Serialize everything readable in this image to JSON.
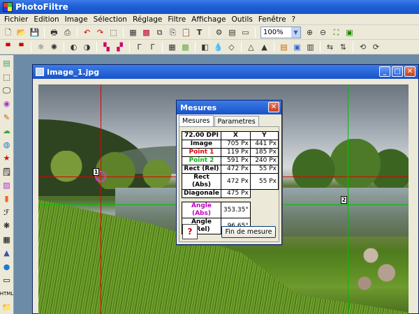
{
  "app": {
    "title": "PhotoFiltre"
  },
  "menu": [
    "Fichier",
    "Edition",
    "Image",
    "Sélection",
    "Réglage",
    "Filtre",
    "Affichage",
    "Outils",
    "Fenêtre",
    "?"
  ],
  "toolbar": {
    "zoom_value": "100%"
  },
  "toolbar_icons": {
    "row1": [
      "new-icon",
      "open-icon",
      "save-icon",
      "print-icon",
      "scan-icon",
      "undo-icon",
      "redo-icon",
      "crop-icon",
      "grayscale-icon",
      "rgb-icon",
      "duplicate-icon",
      "copy-icon",
      "paste-icon",
      "text-icon",
      "plugins-icon",
      "browser-icon",
      "window-icon",
      "zoom-in-icon",
      "zoom-out-icon",
      "fit-icon",
      "fullscreen-icon"
    ],
    "row2": [
      "auto-levels-icon",
      "auto-contrast-icon",
      "brightness-down-icon",
      "brightness-up-icon",
      "contrast-down-icon",
      "contrast-up-icon",
      "saturation-down-icon",
      "saturation-up-icon",
      "gamma-down-icon",
      "gamma-up-icon",
      "color-balance-icon",
      "dust-icon",
      "soften-icon",
      "blur-icon",
      "sharpen-icon",
      "sharpen-more-icon",
      "texture-icon",
      "gradient-icon",
      "frame-icon",
      "flip-h-icon",
      "flip-v-icon",
      "rotate-left-icon",
      "rotate-right-icon"
    ]
  },
  "palette_icons": [
    "layers-icon",
    "selection-icon",
    "monitor-icon",
    "circle-icon",
    "pen-icon",
    "cloud-icon",
    "color-picker-icon",
    "star-icon",
    "note-icon",
    "gradient-icon",
    "fill-icon",
    "effects-icon",
    "pattern-icon",
    "grid-icon",
    "mountain-icon",
    "sphere-icon",
    "scroll-icon",
    "html-icon",
    "folder-icon"
  ],
  "image_window": {
    "title": "Image_1.jpg"
  },
  "markers": {
    "point1": "1",
    "point2": "2"
  },
  "dialog": {
    "title": "Mesures",
    "tabs": [
      "Mesures",
      "Parametres"
    ],
    "header": {
      "dpi": "72.00 DPI",
      "x": "X",
      "y": "Y"
    },
    "rows": [
      {
        "label": "Image",
        "x": "705 Px",
        "y": "441 Px",
        "color": "#000000"
      },
      {
        "label": "Point 1",
        "x": "119 Px",
        "y": "185 Px",
        "color": "#e00000"
      },
      {
        "label": "Point 2",
        "x": "591 Px",
        "y": "240 Px",
        "color": "#00c000"
      },
      {
        "label": "Rect (Rel)",
        "x": "472 Px",
        "y": "55 Px",
        "color": "#000000"
      },
      {
        "label": "Rect (Abs)",
        "x": "472 Px",
        "y": "55 Px",
        "color": "#000000"
      },
      {
        "label": "Diagonale",
        "x": "475 Px",
        "y": "",
        "color": "#000000"
      }
    ],
    "angles": [
      {
        "label": "Angle (Abs)",
        "value": "353.35°",
        "color": "#c000c0"
      },
      {
        "label": "Angle (Rel)",
        "value": "96.65°",
        "color": "#000000"
      }
    ],
    "finish_button": "Fin de mesure"
  },
  "colors": {
    "titlebar": "#1d5fd6",
    "point1_line": "#e00000",
    "point2_line": "#00c000",
    "dialog_bg": "#ece9d8"
  }
}
